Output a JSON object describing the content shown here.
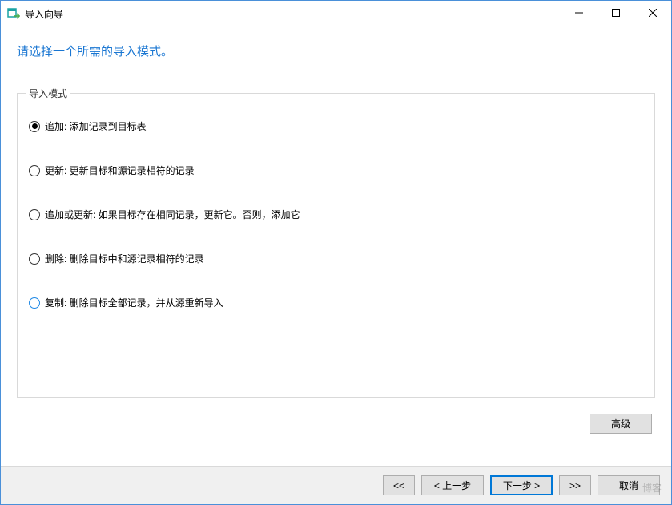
{
  "titlebar": {
    "title": "导入向导"
  },
  "instruction": "请选择一个所需的导入模式。",
  "group": {
    "label": "导入模式",
    "options": [
      {
        "label": "追加: 添加记录到目标表",
        "selected": true
      },
      {
        "label": "更新: 更新目标和源记录相符的记录",
        "selected": false
      },
      {
        "label": "追加或更新: 如果目标存在相同记录，更新它。否则，添加它",
        "selected": false
      },
      {
        "label": "删除: 删除目标中和源记录相符的记录",
        "selected": false
      },
      {
        "label": "复制: 删除目标全部记录，并从源重新导入",
        "selected": false,
        "highlight": true
      }
    ]
  },
  "buttons": {
    "advanced": "高级",
    "first": "<<",
    "back": "< 上一步",
    "next": "下一步 >",
    "last": ">>",
    "cancel": "取消"
  },
  "watermark": "博客"
}
